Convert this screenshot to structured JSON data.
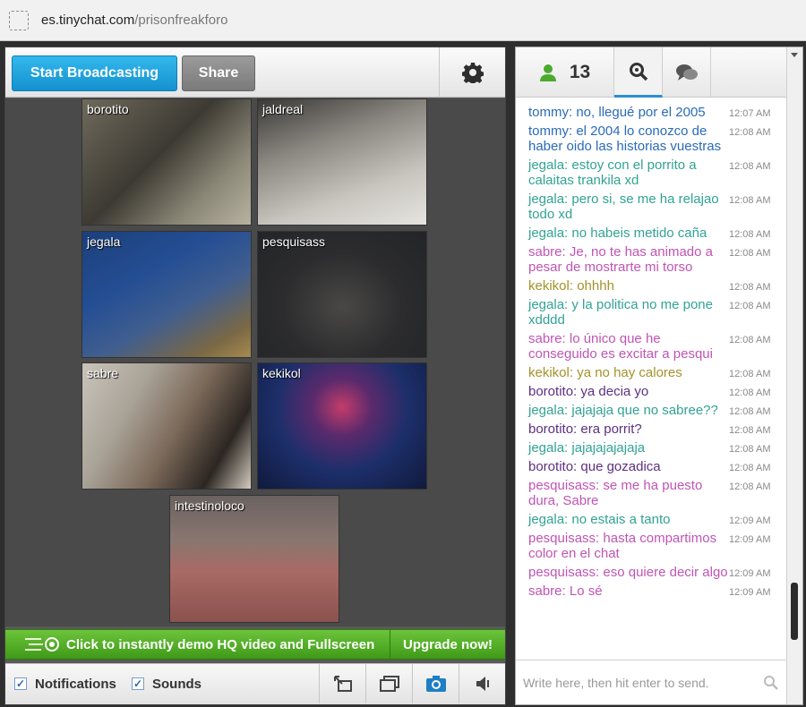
{
  "browser": {
    "url_host": "es.tinychat.com",
    "url_path": "/prisonfreakforo"
  },
  "toolbar": {
    "start_label": "Start Broadcasting",
    "share_label": "Share",
    "settings_icon": "gear-icon"
  },
  "videos": [
    {
      "name": "borotito"
    },
    {
      "name": "jaldreal"
    },
    {
      "name": "jegala"
    },
    {
      "name": "pesquisass"
    },
    {
      "name": "sabre"
    },
    {
      "name": "kekikol"
    },
    {
      "name": "intestinoloco"
    }
  ],
  "promo": {
    "text": "Click to instantly demo HQ video and Fullscreen",
    "upgrade_label": "Upgrade now!"
  },
  "bottom": {
    "notifications_label": "Notifications",
    "sounds_label": "Sounds"
  },
  "chat": {
    "user_count": "13",
    "colors": {
      "blue": "#2a6bb8",
      "green": "#31a393",
      "pink": "#c054b5",
      "olive": "#a4922a",
      "purple": "#5d2f82"
    },
    "messages": [
      {
        "user": "tommy",
        "text": "no, llegué por el 2005",
        "time": "12:07 AM",
        "color": "#2a6bb8"
      },
      {
        "user": "tommy",
        "text": "el 2004 lo conozco de haber oido las historias vuestras",
        "time": "12:08 AM",
        "color": "#2a6bb8"
      },
      {
        "user": "jegala",
        "text": "estoy con el porrito a calaitas trankila xd",
        "time": "12:08 AM",
        "color": "#31a393"
      },
      {
        "user": "jegala",
        "text": "pero si, se me ha relajao todo xd",
        "time": "12:08 AM",
        "color": "#31a393"
      },
      {
        "user": "jegala",
        "text": "no habeis metido caña",
        "time": "12:08 AM",
        "color": "#31a393"
      },
      {
        "user": "sabre",
        "text": "Je, no te has animado a pesar de mostrarte mi torso",
        "time": "12:08 AM",
        "color": "#c054b5"
      },
      {
        "user": "kekikol",
        "text": "ohhhh",
        "time": "12:08 AM",
        "color": "#a4922a"
      },
      {
        "user": "jegala",
        "text": "y la politica no me pone xdddd",
        "time": "12:08 AM",
        "color": "#31a393"
      },
      {
        "user": "sabre",
        "text": "lo único que he conseguido es excitar a pesqui",
        "time": "12:08 AM",
        "color": "#c054b5"
      },
      {
        "user": "kekikol",
        "text": "ya no hay calores",
        "time": "12:08 AM",
        "color": "#a4922a"
      },
      {
        "user": "borotito",
        "text": "ya decia yo",
        "time": "12:08 AM",
        "color": "#5d2f82"
      },
      {
        "user": "jegala",
        "text": "jajajaja que no sabree??",
        "time": "12:08 AM",
        "color": "#31a393"
      },
      {
        "user": "borotito",
        "text": "era porrit?",
        "time": "12:08 AM",
        "color": "#5d2f82"
      },
      {
        "user": "jegala",
        "text": "jajajajajajaja",
        "time": "12:08 AM",
        "color": "#31a393"
      },
      {
        "user": "borotito",
        "text": "que gozadica",
        "time": "12:08 AM",
        "color": "#5d2f82"
      },
      {
        "user": "pesquisass",
        "text": "se me ha puesto dura, Sabre",
        "time": "12:08 AM",
        "color": "#c054b5"
      },
      {
        "user": "jegala",
        "text": "no estais a tanto",
        "time": "12:09 AM",
        "color": "#31a393"
      },
      {
        "user": "pesquisass",
        "text": "hasta compartimos color en el chat",
        "time": "12:09 AM",
        "color": "#c054b5"
      },
      {
        "user": "pesquisass",
        "text": "eso quiere decir algo",
        "time": "12:09 AM",
        "color": "#c054b5"
      },
      {
        "user": "sabre",
        "text": "Lo sé",
        "time": "12:09 AM",
        "color": "#c054b5"
      }
    ],
    "input_placeholder": "Write here, then hit enter to send."
  }
}
